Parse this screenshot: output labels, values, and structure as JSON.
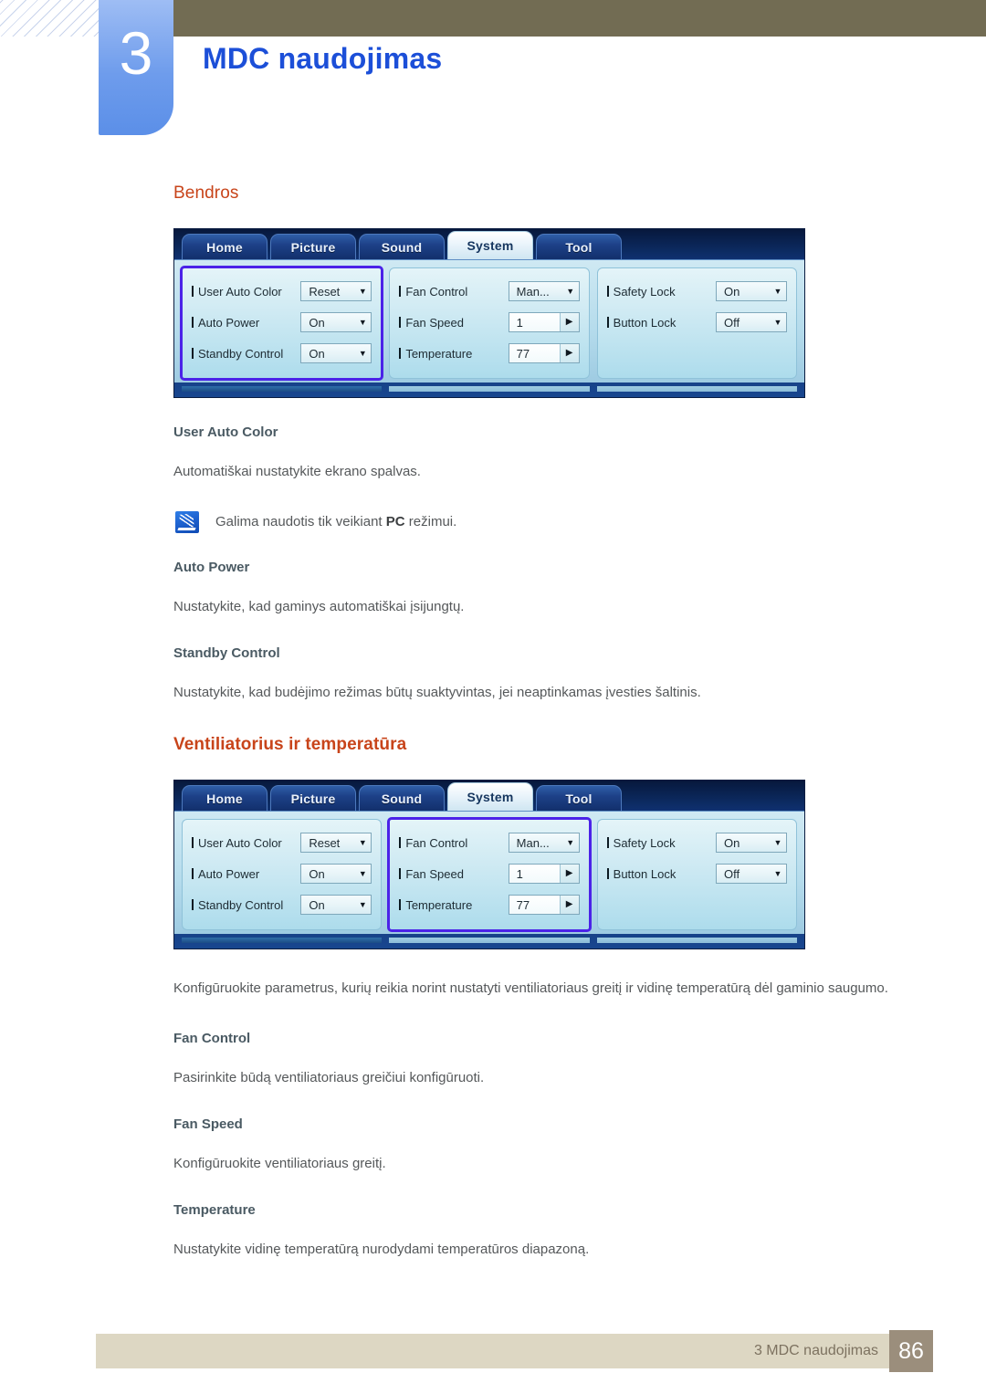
{
  "header": {
    "chapter_number": "3",
    "chapter_title": "MDC naudojimas"
  },
  "sections": {
    "general": {
      "heading": "Bendros",
      "user_auto_color": {
        "heading": "User Auto Color",
        "body": "Automatiškai nustatykite ekrano spalvas.",
        "note_pre": "Galima naudotis tik veikiant ",
        "note_bold": "PC",
        "note_post": " režimui."
      },
      "auto_power": {
        "heading": "Auto Power",
        "body": "Nustatykite, kad gaminys automatiškai įsijungtų."
      },
      "standby_control": {
        "heading": "Standby Control",
        "body": "Nustatykite, kad budėjimo režimas būtų suaktyvintas, jei neaptinkamas įvesties šaltinis."
      }
    },
    "fan": {
      "heading": "Ventiliatorius ir temperatūra",
      "body": "Konfigūruokite parametrus, kurių reikia norint nustatyti ventiliatoriaus greitį ir vidinę temperatūrą dėl gaminio saugumo.",
      "fan_control": {
        "heading": "Fan Control",
        "body": "Pasirinkite būdą ventiliatoriaus greičiui konfigūruoti."
      },
      "fan_speed": {
        "heading": "Fan Speed",
        "body": "Konfigūruokite ventiliatoriaus greitį."
      },
      "temperature": {
        "heading": "Temperature",
        "body": "Nustatykite vidinę temperatūrą nurodydami temperatūros diapazoną."
      }
    }
  },
  "mdc": {
    "tabs": [
      {
        "label": "Home",
        "active": false
      },
      {
        "label": "Picture",
        "active": false
      },
      {
        "label": "Sound",
        "active": false
      },
      {
        "label": "System",
        "active": true
      },
      {
        "label": "Tool",
        "active": false
      }
    ],
    "group_left": {
      "rows": [
        {
          "label": "User Auto Color",
          "value": "Reset",
          "type": "dropdown",
          "icon": "chevron-down-icon"
        },
        {
          "label": "Auto Power",
          "value": "On",
          "type": "dropdown",
          "icon": "chevron-down-icon"
        },
        {
          "label": "Standby Control",
          "value": "On",
          "type": "dropdown",
          "icon": "chevron-down-icon"
        }
      ]
    },
    "group_middle": {
      "rows": [
        {
          "label": "Fan Control",
          "value": "Man...",
          "type": "dropdown",
          "icon": "chevron-down-icon"
        },
        {
          "label": "Fan Speed",
          "value": "1",
          "type": "spinner",
          "icon": "chevron-right-icon"
        },
        {
          "label": "Temperature",
          "value": "77",
          "type": "spinner",
          "icon": "chevron-right-icon"
        }
      ]
    },
    "group_right": {
      "rows": [
        {
          "label": "Safety Lock",
          "value": "On",
          "type": "dropdown",
          "icon": "chevron-down-icon"
        },
        {
          "label": "Button Lock",
          "value": "Off",
          "type": "dropdown",
          "icon": "chevron-down-icon"
        }
      ]
    },
    "selection_first": "left",
    "selection_second": "middle"
  },
  "footer": {
    "text": "3 MDC naudojimas",
    "page": "86"
  },
  "colors": {
    "accent_heading": "#c8441a",
    "chapter_title": "#1c4fd8",
    "chapter_tab": "#6e9cec",
    "olive_bar": "#726c53",
    "selection_outline": "#4b22e8",
    "footer_bar": "#ddd7c3",
    "footer_page_box": "#9b8e7c"
  }
}
